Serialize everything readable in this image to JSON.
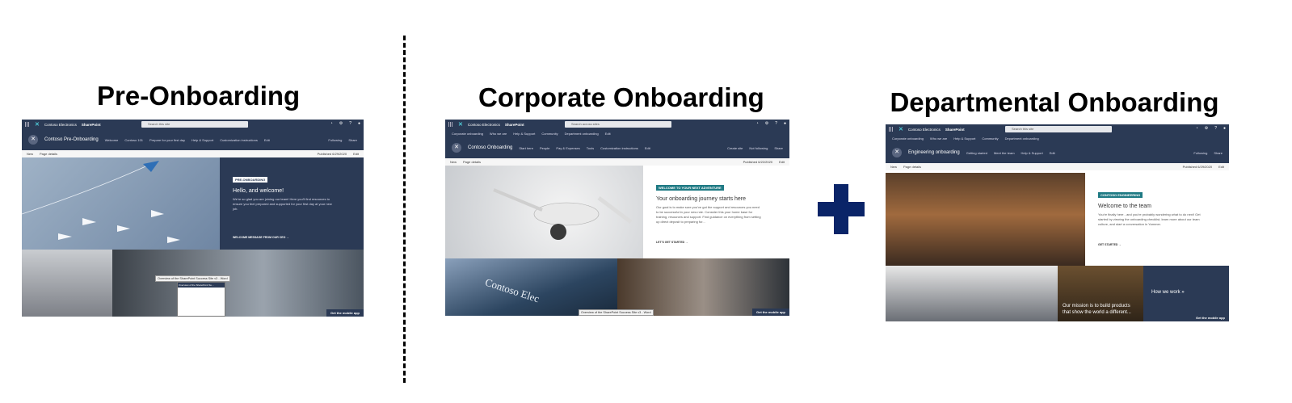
{
  "headings": {
    "pre": "Pre-Onboarding",
    "corporate": "Corporate Onboarding",
    "departmental": "Departmental Onboarding"
  },
  "pre": {
    "org": "Contoso Electronics",
    "app": "SharePoint",
    "search": "Search this site",
    "site_title": "Contoso Pre-Onboarding",
    "nav": [
      "Welcome",
      "Contoso 101",
      "Prepare for your first day",
      "Help & Support",
      "Customization instructions",
      "Edit"
    ],
    "following": "Following",
    "share": "Share",
    "new": "New",
    "page_details": "Page details",
    "published": "Published 6/29/2020",
    "edit": "Edit",
    "badge": "PRE-ONBOARDING",
    "hero_title": "Hello, and welcome!",
    "hero_body": "We're so glad you are joining our team! Here you'll find resources to ensure you feel prepared and supported for your first day at your new job.",
    "hero_link": "WELCOME MESSAGE FROM OUR CEO →",
    "doc_tooltip": "Overview of the SharePoint Success Site v3 - Word",
    "doc_caption": "Overview of the SharePoint Su...",
    "mobile": "Get the mobile app"
  },
  "corporate": {
    "org": "Contoso Electronics",
    "app": "SharePoint",
    "search": "Search across sites",
    "hub_nav": [
      "Corporate onboarding",
      "Who we are",
      "Help & Support",
      "Community",
      "Department onboarding",
      "Edit"
    ],
    "site_title": "Contoso Onboarding",
    "nav": [
      "Start here",
      "People",
      "Pay & Expenses",
      "Tools",
      "Customization instructions",
      "Edit"
    ],
    "create_site": "Create site",
    "not_following": "Not following",
    "share": "Share",
    "new": "New",
    "page_details": "Page details",
    "published": "Published 6/22/2020",
    "edit": "Edit",
    "badge": "WELCOME TO YOUR NEXT ADVENTURE",
    "hero_title": "Your onboarding journey starts here",
    "hero_body": "Our goal is to make sure you've got the support and resources you need to be successful in your new role. Consider this your home base for training, resources and support. Find guidance on everything from setting up direct deposit to preparing for...",
    "hero_link": "LET'S GET STARTED →",
    "building_sign": "Contoso Elec",
    "doc_tooltip": "Overview of the SharePoint Success Site v3 - Word",
    "mobile": "Get the mobile app"
  },
  "departmental": {
    "org": "Contoso Electronics",
    "app": "SharePoint",
    "search": "Search this site",
    "hub_nav": [
      "Corporate onboarding",
      "Who we are",
      "Help & Support",
      "Community",
      "Department onboarding"
    ],
    "site_title": "Engineering onboarding",
    "nav": [
      "Getting started",
      "Meet the team",
      "Help & Support",
      "Edit"
    ],
    "following": "Following",
    "share": "Share",
    "new": "New",
    "page_details": "Page details",
    "published": "Published 6/29/2020",
    "edit": "Edit",
    "badge": "CONTOSO ENGINEERING",
    "hero_title": "Welcome to the team",
    "hero_body": "You're finally here - and you're probably wondering what to do next! Get started by viewing the onboarding checklist, learn more about our team culture, and start a conversation in Yammer.",
    "hero_link": "GET STARTED →",
    "mission": "Our mission is to build products that show the world a different...",
    "how_we_work": "How we work »",
    "mobile": "Get the mobile app"
  },
  "colors": {
    "suite_bar": "#2b3a55",
    "plus_sign": "#0a2468",
    "accent_teal": "#1f7a84"
  }
}
